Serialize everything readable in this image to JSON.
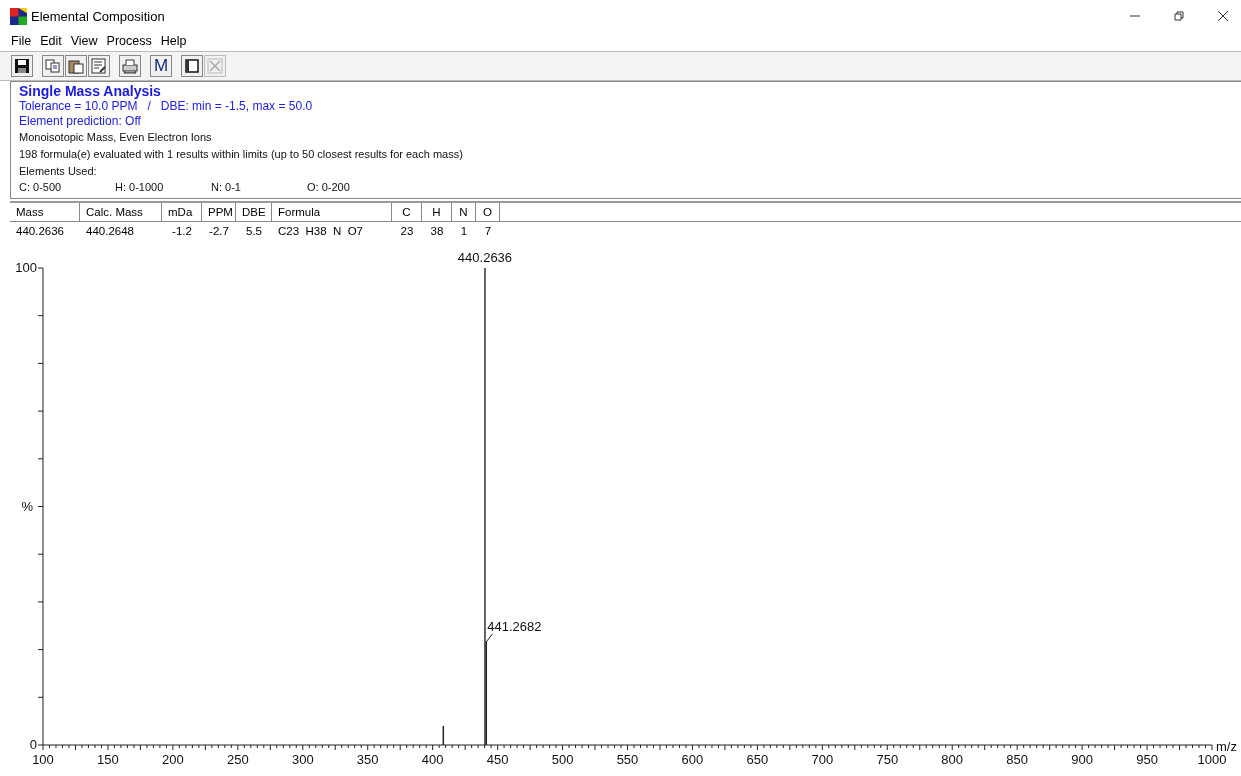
{
  "window": {
    "title": "Elemental Composition"
  },
  "menu": [
    "File",
    "Edit",
    "View",
    "Process",
    "Help"
  ],
  "toolbar": [
    {
      "kind": "save",
      "disabled": false
    },
    {
      "kind": "copy",
      "disabled": false
    },
    {
      "kind": "paste",
      "disabled": false
    },
    {
      "kind": "properties",
      "disabled": false
    },
    {
      "kind": "print",
      "disabled": false
    },
    {
      "kind": "text",
      "label": "M",
      "disabled": false
    },
    {
      "kind": "window",
      "disabled": false
    },
    {
      "kind": "close",
      "disabled": true
    }
  ],
  "info": {
    "heading": "Single Mass Analysis",
    "settings": [
      "Tolerance = 10.0 PPM   /   DBE: min = -1.5, max = 50.0",
      "Element prediction: Off"
    ],
    "notes": [
      "Monoisotopic Mass, Even Electron Ions",
      "198 formula(e) evaluated with 1 results within limits (up to 50 closest results for each mass)"
    ],
    "elements_label": "Elements Used:",
    "elements": [
      "C: 0-500",
      "H: 0-1000",
      "N: 0-1",
      "O: 0-200"
    ]
  },
  "table": {
    "columns": [
      "Mass",
      "Calc. Mass",
      "mDa",
      "PPM",
      "DBE",
      "Formula",
      "C",
      "H",
      "N",
      "O"
    ],
    "rows": [
      [
        "440.2636",
        "440.2648",
        "-1.2",
        "-2.7",
        "5.5",
        "C23  H38  N  O7",
        "23",
        "38",
        "1",
        "7"
      ]
    ]
  },
  "spectrum": {
    "chart_data": {
      "type": "bar",
      "xlabel": "m/z",
      "ylabel": "%",
      "x": [
        408.2,
        440.2636,
        441.2682
      ],
      "values": [
        4,
        100,
        21.6
      ],
      "xlim": [
        100,
        1000
      ],
      "ylim": [
        0,
        100
      ],
      "xticks": [
        100,
        150,
        200,
        250,
        300,
        350,
        400,
        450,
        500,
        550,
        600,
        650,
        700,
        750,
        800,
        850,
        900,
        950,
        1000
      ],
      "yticks": [
        0,
        100
      ]
    },
    "peak_labels": [
      "440.2636",
      "441.2682"
    ]
  }
}
